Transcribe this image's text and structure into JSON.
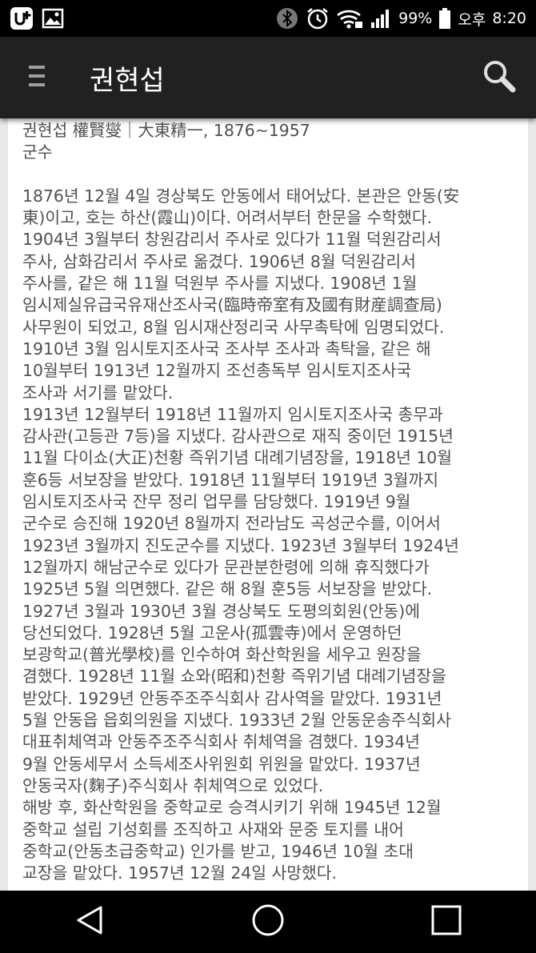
{
  "status_bar": {
    "battery_percent": "99%",
    "ampm": "오후",
    "time": "8:20",
    "icons": [
      "u-plus-icon",
      "gallery-icon",
      "bluetooth-icon",
      "alarm-icon",
      "wifi-lock-icon",
      "signal-icon",
      "battery-icon"
    ]
  },
  "app_bar": {
    "title": "권현섭",
    "menu_icon": "menu-icon",
    "search_icon": "search-icon"
  },
  "article": {
    "header_lines": [
      "권현섭 權賢燮｜大東精一, 1876~1957",
      "군수"
    ],
    "body_lines": [
      "1876년 12월 4일 경상북도 안동에서 태어났다. 본관은 안동(安",
      "東)이고, 호는 하산(霞山)이다. 어려서부터 한문을 수학했다.",
      "1904년 3월부터 창원감리서 주사로 있다가 11월 덕원감리서",
      "주사, 삼화감리서 주사로 옮겼다. 1906년 8월 덕원감리서",
      "주사를, 같은 해 11월 덕원부 주사를 지냈다. 1908년 1월",
      "임시제실유급국유재산조사국(臨時帝室有及國有財産調查局)",
      "사무원이 되었고, 8월 임시재산정리국 사무촉탁에 임명되었다.",
      "1910년 3월 임시토지조사국 조사부 조사과 촉탁을, 같은 해",
      "10월부터 1913년 12월까지 조선총독부 임시토지조사국",
      "조사과 서기를 맡았다.",
      "1913년 12월부터 1918년 11월까지 임시토지조사국 총무과",
      "감사관(고등관 7등)을 지냈다. 감사관으로 재직 중이던 1915년",
      "11월 다이쇼(大正)천황 즉위기념 대례기념장을, 1918년 10월",
      "훈6등 서보장을 받았다. 1918년 11월부터 1919년 3월까지",
      "임시토지조사국 잔무 정리 업무를 담당했다. 1919년 9월",
      "군수로 승진해 1920년 8월까지 전라남도 곡성군수를, 이어서",
      "1923년 3월까지 진도군수를 지냈다. 1923년 3월부터 1924년",
      "12월까지 해남군수로 있다가 문관분한령에 의해 휴직했다가",
      "1925년 5월 의면했다. 같은 해 8월 훈5등 서보장을 받았다.",
      "1927년 3월과 1930년 3월 경상북도 도평의회원(안동)에",
      "당선되었다. 1928년 5월 고운사(孤雲寺)에서 운영하던",
      "보광학교(普光學校)를 인수하여 화산학원을 세우고 원장을",
      "겸했다. 1928년 11월 쇼와(昭和)천황 즉위기념 대례기념장을",
      "받았다. 1929년 안동주조주식회사 감사역을 맡았다. 1931년",
      "5월 안동읍 읍회의원을 지냈다. 1933년 2월 안동운송주식회사",
      "대표취체역과 안동주조주식회사 취체역을 겸했다. 1934년",
      "9월 안동세무서 소득세조사위원회 위원을 맡았다. 1937년",
      "안동국자(麴子)주식회사 취체역으로 있었다.",
      "해방 후, 화산학원을 중학교로 승격시키기 위해 1945년 12월",
      "중학교 설립 기성회를 조직하고 사재와 문중 토지를 내어",
      "중학교(안동초급중학교) 인가를 받고, 1946년 10월 초대",
      "교장을 맡았다. 1957년 12월 24일 사망했다."
    ]
  },
  "nav_bar": {
    "back_icon": "back-triangle-icon",
    "home_icon": "home-circle-icon",
    "recents_icon": "recents-square-icon"
  }
}
